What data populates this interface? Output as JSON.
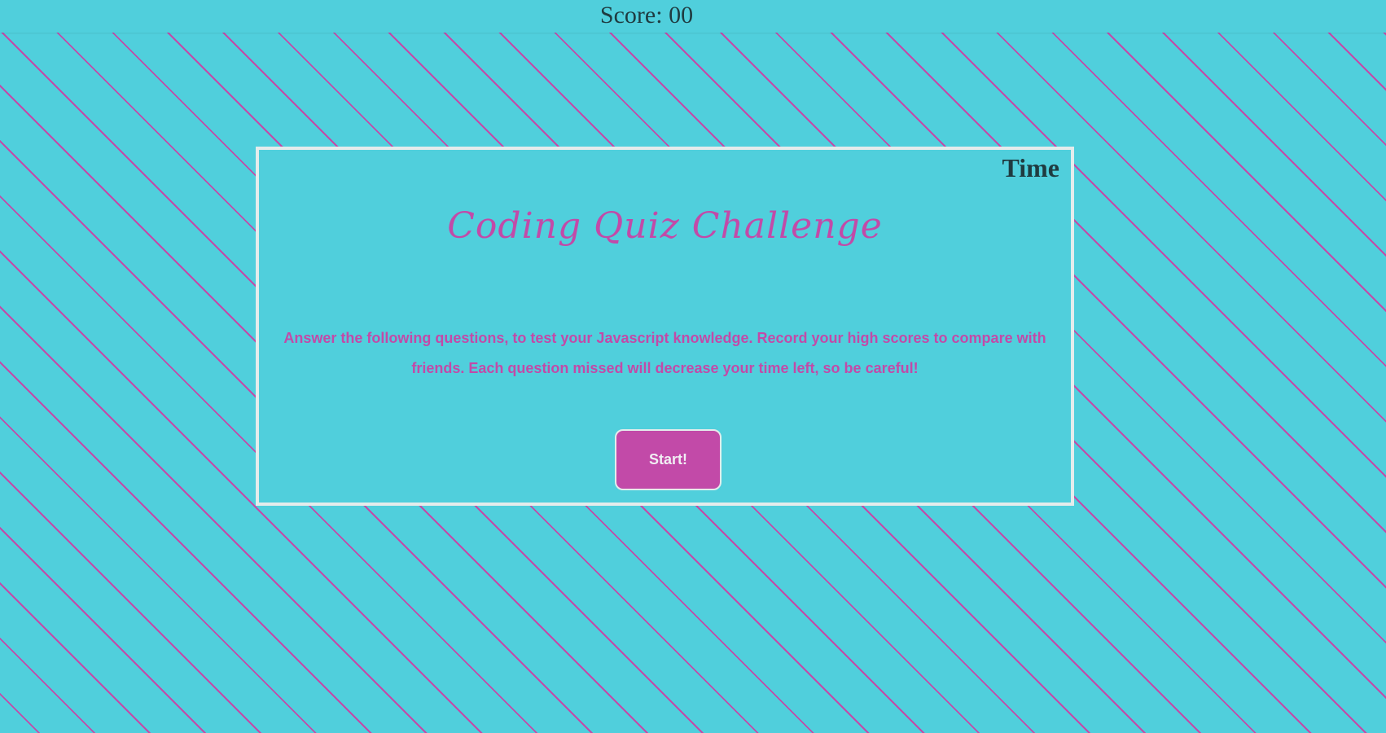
{
  "header": {
    "score_label": "Score: 00"
  },
  "quiz": {
    "timer_label": "Time",
    "title": "Coding Quiz Challenge",
    "instructions": "Answer the following questions, to test your Javascript knowledge. Record your high scores to compare with friends. Each question missed will decrease your time left, so be careful!",
    "start_label": "Start!"
  },
  "colors": {
    "background": "#50cfdc",
    "accent": "#c24aa8",
    "card_border": "#e4ecec",
    "text_dark": "#1f3b40"
  }
}
